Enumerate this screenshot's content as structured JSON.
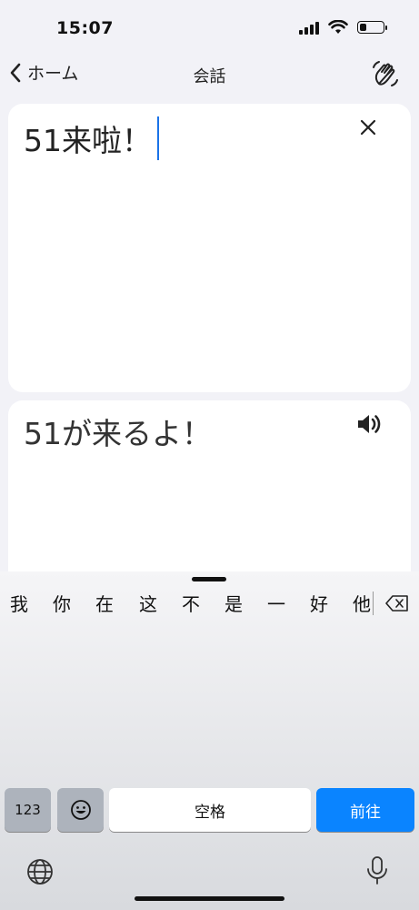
{
  "status_bar": {
    "time": "15:07",
    "battery_level": 0.3
  },
  "nav": {
    "back_label": "ホーム",
    "title": "会話"
  },
  "input_card": {
    "text": "51来啦！"
  },
  "output_card": {
    "text": "51が来るよ！"
  },
  "keyboard": {
    "candidates": [
      "我",
      "你",
      "在",
      "这",
      "不",
      "是",
      "一",
      "好",
      "他"
    ],
    "numbers_key": "123",
    "space_key": "空格",
    "return_key": "前往"
  },
  "colors": {
    "accent": "#0a84ff",
    "caret": "#1a73e8",
    "background": "#f2f2f7"
  },
  "icons": [
    "chevron-left-icon",
    "wave-hand-icon",
    "close-icon",
    "speaker-icon",
    "backspace-icon",
    "emoji-icon",
    "globe-icon",
    "microphone-icon"
  ]
}
